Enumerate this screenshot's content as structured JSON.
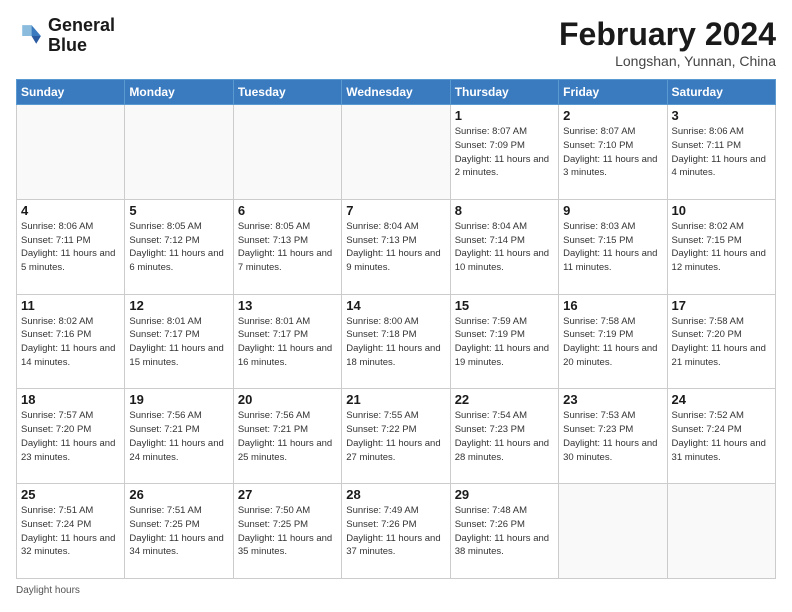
{
  "header": {
    "logo_line1": "General",
    "logo_line2": "Blue",
    "month_year": "February 2024",
    "location": "Longshan, Yunnan, China"
  },
  "days_of_week": [
    "Sunday",
    "Monday",
    "Tuesday",
    "Wednesday",
    "Thursday",
    "Friday",
    "Saturday"
  ],
  "weeks": [
    [
      {
        "num": "",
        "info": ""
      },
      {
        "num": "",
        "info": ""
      },
      {
        "num": "",
        "info": ""
      },
      {
        "num": "",
        "info": ""
      },
      {
        "num": "1",
        "info": "Sunrise: 8:07 AM\nSunset: 7:09 PM\nDaylight: 11 hours\nand 2 minutes."
      },
      {
        "num": "2",
        "info": "Sunrise: 8:07 AM\nSunset: 7:10 PM\nDaylight: 11 hours\nand 3 minutes."
      },
      {
        "num": "3",
        "info": "Sunrise: 8:06 AM\nSunset: 7:11 PM\nDaylight: 11 hours\nand 4 minutes."
      }
    ],
    [
      {
        "num": "4",
        "info": "Sunrise: 8:06 AM\nSunset: 7:11 PM\nDaylight: 11 hours\nand 5 minutes."
      },
      {
        "num": "5",
        "info": "Sunrise: 8:05 AM\nSunset: 7:12 PM\nDaylight: 11 hours\nand 6 minutes."
      },
      {
        "num": "6",
        "info": "Sunrise: 8:05 AM\nSunset: 7:13 PM\nDaylight: 11 hours\nand 7 minutes."
      },
      {
        "num": "7",
        "info": "Sunrise: 8:04 AM\nSunset: 7:13 PM\nDaylight: 11 hours\nand 9 minutes."
      },
      {
        "num": "8",
        "info": "Sunrise: 8:04 AM\nSunset: 7:14 PM\nDaylight: 11 hours\nand 10 minutes."
      },
      {
        "num": "9",
        "info": "Sunrise: 8:03 AM\nSunset: 7:15 PM\nDaylight: 11 hours\nand 11 minutes."
      },
      {
        "num": "10",
        "info": "Sunrise: 8:02 AM\nSunset: 7:15 PM\nDaylight: 11 hours\nand 12 minutes."
      }
    ],
    [
      {
        "num": "11",
        "info": "Sunrise: 8:02 AM\nSunset: 7:16 PM\nDaylight: 11 hours\nand 14 minutes."
      },
      {
        "num": "12",
        "info": "Sunrise: 8:01 AM\nSunset: 7:17 PM\nDaylight: 11 hours\nand 15 minutes."
      },
      {
        "num": "13",
        "info": "Sunrise: 8:01 AM\nSunset: 7:17 PM\nDaylight: 11 hours\nand 16 minutes."
      },
      {
        "num": "14",
        "info": "Sunrise: 8:00 AM\nSunset: 7:18 PM\nDaylight: 11 hours\nand 18 minutes."
      },
      {
        "num": "15",
        "info": "Sunrise: 7:59 AM\nSunset: 7:19 PM\nDaylight: 11 hours\nand 19 minutes."
      },
      {
        "num": "16",
        "info": "Sunrise: 7:58 AM\nSunset: 7:19 PM\nDaylight: 11 hours\nand 20 minutes."
      },
      {
        "num": "17",
        "info": "Sunrise: 7:58 AM\nSunset: 7:20 PM\nDaylight: 11 hours\nand 21 minutes."
      }
    ],
    [
      {
        "num": "18",
        "info": "Sunrise: 7:57 AM\nSunset: 7:20 PM\nDaylight: 11 hours\nand 23 minutes."
      },
      {
        "num": "19",
        "info": "Sunrise: 7:56 AM\nSunset: 7:21 PM\nDaylight: 11 hours\nand 24 minutes."
      },
      {
        "num": "20",
        "info": "Sunrise: 7:56 AM\nSunset: 7:21 PM\nDaylight: 11 hours\nand 25 minutes."
      },
      {
        "num": "21",
        "info": "Sunrise: 7:55 AM\nSunset: 7:22 PM\nDaylight: 11 hours\nand 27 minutes."
      },
      {
        "num": "22",
        "info": "Sunrise: 7:54 AM\nSunset: 7:23 PM\nDaylight: 11 hours\nand 28 minutes."
      },
      {
        "num": "23",
        "info": "Sunrise: 7:53 AM\nSunset: 7:23 PM\nDaylight: 11 hours\nand 30 minutes."
      },
      {
        "num": "24",
        "info": "Sunrise: 7:52 AM\nSunset: 7:24 PM\nDaylight: 11 hours\nand 31 minutes."
      }
    ],
    [
      {
        "num": "25",
        "info": "Sunrise: 7:51 AM\nSunset: 7:24 PM\nDaylight: 11 hours\nand 32 minutes."
      },
      {
        "num": "26",
        "info": "Sunrise: 7:51 AM\nSunset: 7:25 PM\nDaylight: 11 hours\nand 34 minutes."
      },
      {
        "num": "27",
        "info": "Sunrise: 7:50 AM\nSunset: 7:25 PM\nDaylight: 11 hours\nand 35 minutes."
      },
      {
        "num": "28",
        "info": "Sunrise: 7:49 AM\nSunset: 7:26 PM\nDaylight: 11 hours\nand 37 minutes."
      },
      {
        "num": "29",
        "info": "Sunrise: 7:48 AM\nSunset: 7:26 PM\nDaylight: 11 hours\nand 38 minutes."
      },
      {
        "num": "",
        "info": ""
      },
      {
        "num": "",
        "info": ""
      }
    ]
  ],
  "footer": {
    "text": "Daylight hours"
  }
}
